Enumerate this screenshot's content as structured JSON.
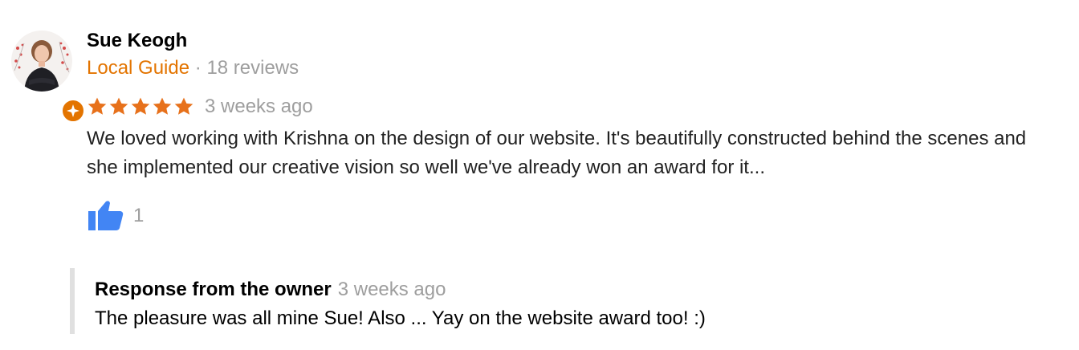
{
  "reviewer": {
    "name": "Sue Keogh",
    "badge": "Local Guide",
    "separator": "·",
    "reviews_count": "18 reviews",
    "avatar_icon": "person-photo-icon",
    "badge_icon": "local-guide-star-icon"
  },
  "review": {
    "rating": 5,
    "rating_max": 5,
    "date": "3 weeks ago",
    "text": "We loved working with Krishna on the design of our website. It's beautifully constructed behind the scenes and she implemented our creative vision so well we've already won an award for it...",
    "like_icon": "thumbs-up-icon",
    "likes": "1"
  },
  "owner_response": {
    "title": "Response from the owner",
    "date": "3 weeks ago",
    "text": "The pleasure was all mine Sue! Also ... Yay on the website award too! :)"
  },
  "colors": {
    "accent": "#e37400",
    "star": "#e7711b",
    "like": "#4285f4",
    "muted": "#9e9e9e",
    "border": "#e0e0e0"
  }
}
